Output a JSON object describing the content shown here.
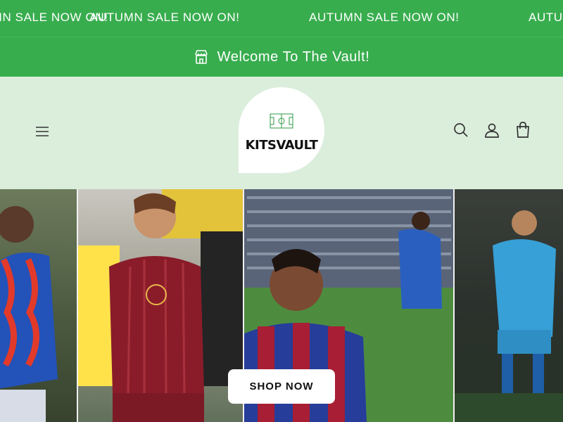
{
  "announcement": {
    "marquee_items": [
      "AUTUMN SALE NOW ON!",
      "AUTUMN SALE NOW ON!",
      "AUTUMN SALE NOW ON!",
      "AUTUMN SALE NOW ON!"
    ],
    "welcome_text": "Welcome To The Vault!",
    "welcome_icon": "store-icon"
  },
  "header": {
    "menu_icon": "hamburger-menu-icon",
    "logo_text": "KITSVAULT",
    "icons": [
      "search-icon",
      "account-icon",
      "cart-icon"
    ]
  },
  "hero": {
    "cta_label": "SHOP NOW"
  },
  "colors": {
    "brand_green": "#38ad4e",
    "header_bg": "#dbeedc"
  }
}
